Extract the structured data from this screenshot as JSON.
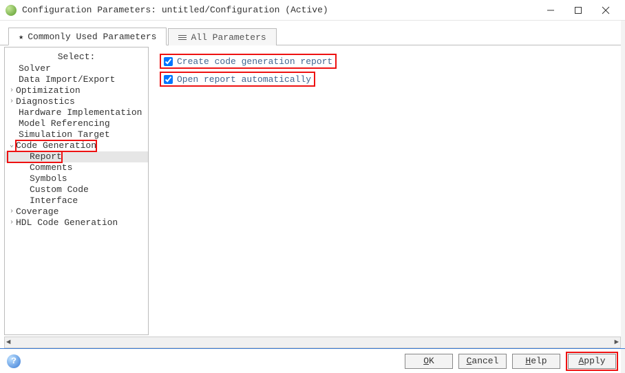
{
  "window": {
    "title": "Configuration Parameters: untitled/Configuration (Active)"
  },
  "tabs": {
    "common": "Commonly Used Parameters",
    "all": "All Parameters"
  },
  "sidebar": {
    "header": "Select:",
    "items": [
      {
        "label": "Solver",
        "expander": "",
        "indent": 1
      },
      {
        "label": "Data Import/Export",
        "expander": "",
        "indent": 1
      },
      {
        "label": "Optimization",
        "expander": ">",
        "indent": 0
      },
      {
        "label": "Diagnostics",
        "expander": ">",
        "indent": 0
      },
      {
        "label": "Hardware Implementation",
        "expander": "",
        "indent": 1
      },
      {
        "label": "Model Referencing",
        "expander": "",
        "indent": 1
      },
      {
        "label": "Simulation Target",
        "expander": "",
        "indent": 1
      },
      {
        "label": "Code Generation",
        "expander": "v",
        "indent": 0,
        "highlight": true
      },
      {
        "label": "Report",
        "expander": "",
        "indent": 2,
        "selected": true,
        "highlight": true
      },
      {
        "label": "Comments",
        "expander": "",
        "indent": 2
      },
      {
        "label": "Symbols",
        "expander": "",
        "indent": 2
      },
      {
        "label": "Custom Code",
        "expander": "",
        "indent": 2
      },
      {
        "label": "Interface",
        "expander": "",
        "indent": 2
      },
      {
        "label": "Coverage",
        "expander": ">",
        "indent": 0
      },
      {
        "label": "HDL Code Generation",
        "expander": ">",
        "indent": 0
      }
    ]
  },
  "options": {
    "create_report": {
      "label": "Create code generation report",
      "checked": true
    },
    "open_report": {
      "label": "Open report automatically",
      "checked": true
    }
  },
  "buttons": {
    "ok": {
      "u": "O",
      "rest": "K"
    },
    "cancel": {
      "u": "C",
      "rest": "ancel"
    },
    "help": {
      "u": "H",
      "rest": "elp"
    },
    "apply": {
      "u": "A",
      "rest": "pply"
    }
  }
}
